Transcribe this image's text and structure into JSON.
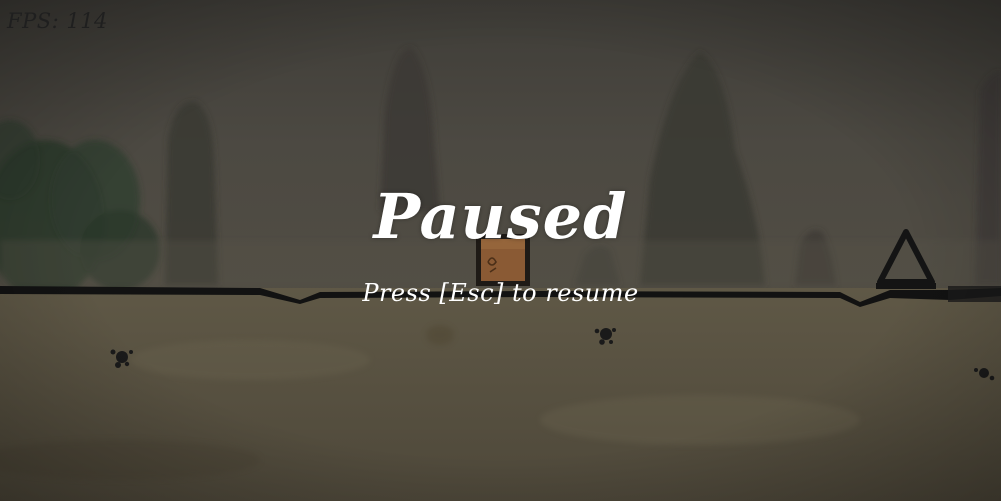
{
  "hud": {
    "fps_label": "FPS: 114"
  },
  "pause_overlay": {
    "title": "Paused",
    "hint": "Press [Esc] to resume"
  },
  "colors": {
    "sky": "#4a4740",
    "ground": "#5a5443",
    "ground_line": "#121212",
    "overlay_text": "#ffffff",
    "fps_text": "#1f1f1f"
  },
  "icons": {
    "player": "crate-block-icon",
    "spike": "triangle-spike-icon"
  }
}
